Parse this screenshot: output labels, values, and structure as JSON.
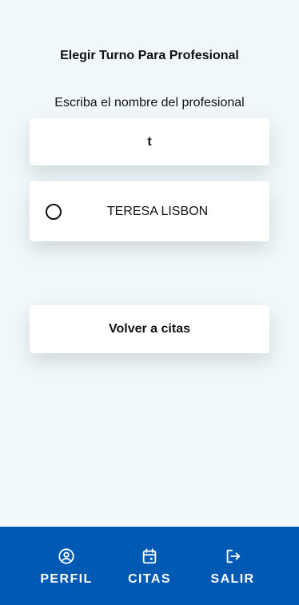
{
  "page": {
    "title": "Elegir Turno Para Profesional"
  },
  "search": {
    "label": "Escriba el nombre del profesional",
    "value": "t"
  },
  "results": [
    {
      "name": "TERESA LISBON",
      "selected": false
    }
  ],
  "actions": {
    "back_label": "Volver a citas"
  },
  "bottom_nav": {
    "background": "#0059b3",
    "items": [
      {
        "label": "PERFIL",
        "icon": "account-circle-icon"
      },
      {
        "label": "CITAS",
        "icon": "calendar-event-icon"
      },
      {
        "label": "SALIR",
        "icon": "logout-icon"
      }
    ]
  }
}
